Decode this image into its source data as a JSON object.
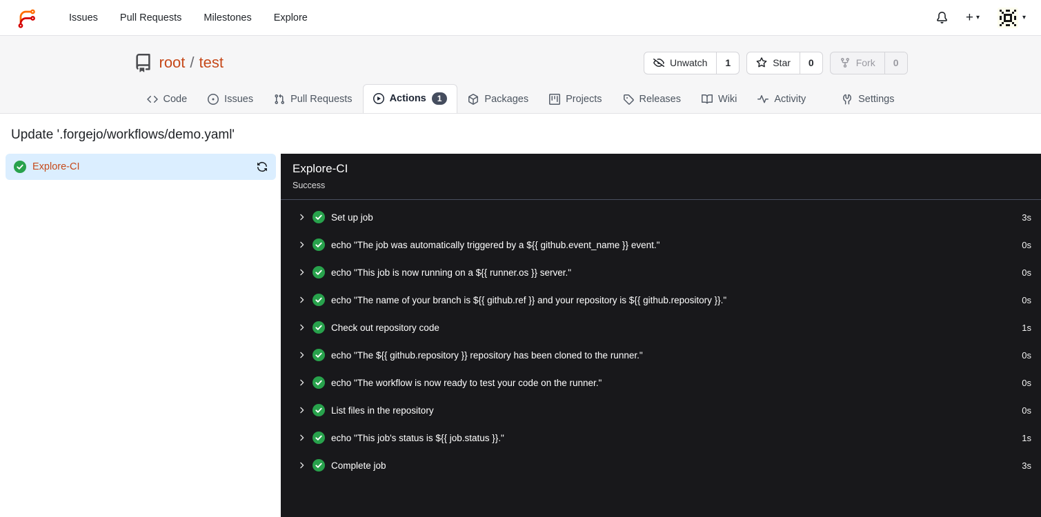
{
  "navbar": {
    "links": [
      "Issues",
      "Pull Requests",
      "Milestones",
      "Explore"
    ],
    "plus_label": "+"
  },
  "repo": {
    "owner": "root",
    "separator": "/",
    "name": "test",
    "actions": [
      {
        "label": "Unwatch",
        "count": "1"
      },
      {
        "label": "Star",
        "count": "0"
      },
      {
        "label": "Fork",
        "count": "0"
      }
    ]
  },
  "tabs": [
    {
      "label": "Code"
    },
    {
      "label": "Issues"
    },
    {
      "label": "Pull Requests"
    },
    {
      "label": "Actions",
      "badge": "1"
    },
    {
      "label": "Packages"
    },
    {
      "label": "Projects"
    },
    {
      "label": "Releases"
    },
    {
      "label": "Wiki"
    },
    {
      "label": "Activity"
    },
    {
      "label": "Settings"
    }
  ],
  "page": {
    "title": "Update '.forgejo/workflows/demo.yaml'"
  },
  "sidebar": {
    "job": {
      "name": "Explore-CI"
    }
  },
  "panel": {
    "title": "Explore-CI",
    "status": "Success",
    "steps": [
      {
        "name": "Set up job",
        "duration": "3s"
      },
      {
        "name": "echo \"The job was automatically triggered by a ${{ github.event_name }} event.\"",
        "duration": "0s"
      },
      {
        "name": "echo \"This job is now running on a ${{ runner.os }} server.\"",
        "duration": "0s"
      },
      {
        "name": "echo \"The name of your branch is ${{ github.ref }} and your repository is ${{ github.repository }}.\"",
        "duration": "0s"
      },
      {
        "name": "Check out repository code",
        "duration": "1s"
      },
      {
        "name": "echo \"The ${{ github.repository }} repository has been cloned to the runner.\"",
        "duration": "0s"
      },
      {
        "name": "echo \"The workflow is now ready to test your code on the runner.\"",
        "duration": "0s"
      },
      {
        "name": "List files in the repository",
        "duration": "0s"
      },
      {
        "name": "echo \"This job's status is ${{ job.status }}.\"",
        "duration": "1s"
      },
      {
        "name": "Complete job",
        "duration": "3s"
      }
    ]
  },
  "colors": {
    "accent_link": "#c6491a",
    "success_green": "#28a24c",
    "panel_bg": "#18181b",
    "selected_job_bg": "#dbeeff",
    "badge_bg": "#454d5e",
    "logo_orange": "#ff6b00",
    "logo_red": "#d40000"
  }
}
